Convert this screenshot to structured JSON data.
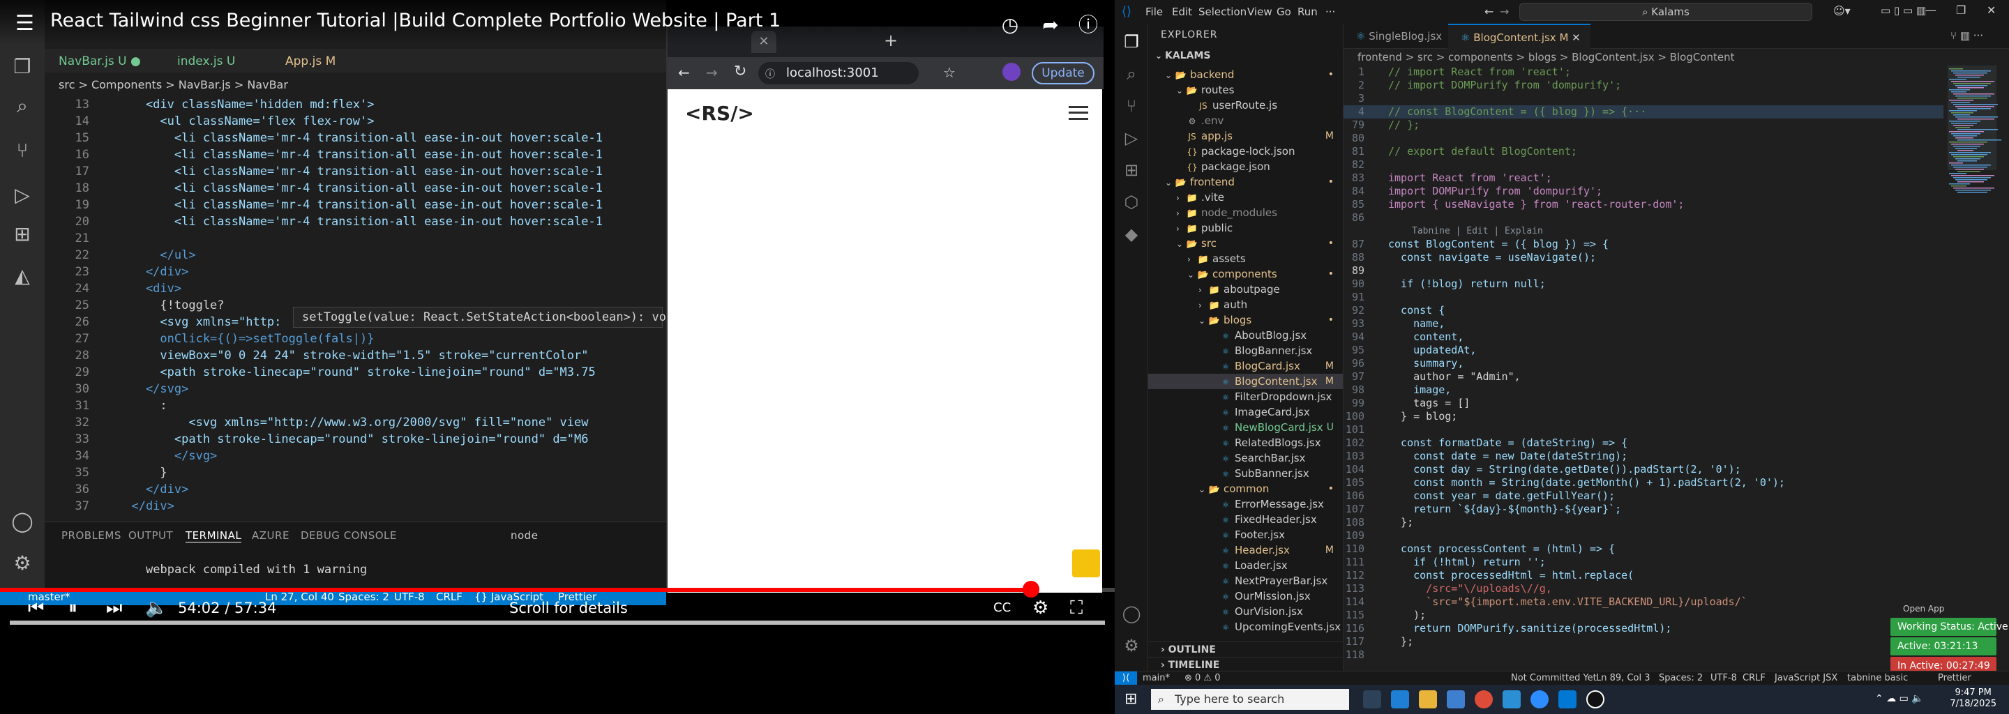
{
  "video": {
    "title": "React Tailwind css Beginner Tutorial |Build Complete Portfolio Website | Part 1",
    "time": "54:02 / 57:34",
    "scroll_hint": "Scroll for details",
    "progress": 0.925,
    "inner_tabs": [
      {
        "label": "NavBar.js",
        "badge": "U"
      },
      {
        "label": "index.js",
        "badge": "U"
      },
      {
        "label": "App.js",
        "badge": "M"
      }
    ],
    "inner_breadcrumb": "src > Components > NavBar.js > NavBar",
    "hover_tooltip": "setToggle(value: React.SetStateAction<boolean>): void",
    "panel_tabs": [
      "PROBLEMS",
      "OUTPUT",
      "TERMINAL",
      "AZURE",
      "DEBUG CONSOLE"
    ],
    "terminal_node": "node",
    "terminal_text": "webpack compiled with 1 warning",
    "status_left": "master*",
    "status_items": [
      "Ln 27, Col 40",
      "Spaces: 2",
      "UTF-8",
      "CRLF",
      "{} JavaScript",
      "Prettier"
    ],
    "browser_url": "localhost:3001",
    "browser_update": "Update",
    "site_logo": "<RS/>",
    "code_lines": [
      {
        "n": "13",
        "t": "    <div className='hidden md:flex'>"
      },
      {
        "n": "14",
        "t": "      <ul className='flex flex-row'>"
      },
      {
        "n": "15",
        "t": "        <li className='mr-4 transition-all ease-in-out hover:scale-1"
      },
      {
        "n": "16",
        "t": "        <li className='mr-4 transition-all ease-in-out hover:scale-1"
      },
      {
        "n": "17",
        "t": "        <li className='mr-4 transition-all ease-in-out hover:scale-1"
      },
      {
        "n": "18",
        "t": "        <li className='mr-4 transition-all ease-in-out hover:scale-1"
      },
      {
        "n": "19",
        "t": "        <li className='mr-4 transition-all ease-in-out hover:scale-1"
      },
      {
        "n": "20",
        "t": "        <li className='mr-4 transition-all ease-in-out hover:scale-1"
      },
      {
        "n": "21",
        "t": ""
      },
      {
        "n": "22",
        "t": "      </ul>"
      },
      {
        "n": "23",
        "t": "    </div>"
      },
      {
        "n": "24",
        "t": "    <div>"
      },
      {
        "n": "25",
        "t": "      {!toggle?"
      },
      {
        "n": "26",
        "t": "      <svg xmlns=\"http:"
      },
      {
        "n": "27",
        "t": "      onClick={()=>setToggle(fals|)}"
      },
      {
        "n": "28",
        "t": "      viewBox=\"0 0 24 24\" stroke-width=\"1.5\" stroke=\"currentColor\""
      },
      {
        "n": "29",
        "t": "      <path stroke-linecap=\"round\" stroke-linejoin=\"round\" d=\"M3.75"
      },
      {
        "n": "30",
        "t": "    </svg>"
      },
      {
        "n": "31",
        "t": "      :"
      },
      {
        "n": "32",
        "t": "          <svg xmlns=\"http://www.w3.org/2000/svg\" fill=\"none\" view"
      },
      {
        "n": "33",
        "t": "        <path stroke-linecap=\"round\" stroke-linejoin=\"round\" d=\"M6"
      },
      {
        "n": "34",
        "t": "        </svg>"
      },
      {
        "n": "35",
        "t": "      }"
      },
      {
        "n": "36",
        "t": "    </div>"
      },
      {
        "n": "37",
        "t": "  </div>"
      }
    ]
  },
  "editor": {
    "menu": [
      "File",
      "Edit",
      "Selection",
      "View",
      "Go",
      "Run",
      "···"
    ],
    "search": "Kalams",
    "explorer_title": "EXPLORER",
    "project": "KALAMS",
    "tabs": [
      {
        "label": "SingleBlog.jsx",
        "active": false
      },
      {
        "label": "BlogContent.jsx M",
        "active": true
      }
    ],
    "breadcrumb": "frontend > src > components > blogs > BlogContent.jsx > BlogContent",
    "tree": [
      {
        "label": "backend",
        "depth": 1,
        "type": "folder",
        "open": true,
        "badge": "•",
        "bc": "#e2c08d",
        "color": "#e2c08d"
      },
      {
        "label": "routes",
        "depth": 2,
        "type": "folder",
        "open": true,
        "badge": "",
        "bc": "",
        "color": "#cccccc"
      },
      {
        "label": "userRoute.js",
        "depth": 3,
        "type": "js",
        "open": false,
        "badge": "",
        "bc": "",
        "color": "#cccccc"
      },
      {
        "label": ".env",
        "depth": 2,
        "type": "env",
        "open": false,
        "badge": "",
        "bc": "",
        "color": "#8c8c8c"
      },
      {
        "label": "app.js",
        "depth": 2,
        "type": "js",
        "open": false,
        "badge": "M",
        "bc": "#e2c08d",
        "color": "#e2c08d"
      },
      {
        "label": "package-lock.json",
        "depth": 2,
        "type": "json",
        "open": false,
        "badge": "",
        "bc": "",
        "color": "#cccccc"
      },
      {
        "label": "package.json",
        "depth": 2,
        "type": "json",
        "open": false,
        "badge": "",
        "bc": "",
        "color": "#cccccc"
      },
      {
        "label": "frontend",
        "depth": 1,
        "type": "folder",
        "open": true,
        "badge": "•",
        "bc": "#e2c08d",
        "color": "#e2c08d"
      },
      {
        "label": ".vite",
        "depth": 2,
        "type": "folder",
        "open": false,
        "badge": "",
        "bc": "",
        "color": "#cccccc"
      },
      {
        "label": "node_modules",
        "depth": 2,
        "type": "folder",
        "open": false,
        "badge": "",
        "bc": "",
        "color": "#8c8c8c"
      },
      {
        "label": "public",
        "depth": 2,
        "type": "folder",
        "open": false,
        "badge": "",
        "bc": "",
        "color": "#cccccc"
      },
      {
        "label": "src",
        "depth": 2,
        "type": "folder",
        "open": true,
        "badge": "•",
        "bc": "#e2c08d",
        "color": "#e2c08d"
      },
      {
        "label": "assets",
        "depth": 3,
        "type": "folder",
        "open": false,
        "badge": "",
        "bc": "",
        "color": "#cccccc"
      },
      {
        "label": "components",
        "depth": 3,
        "type": "folder",
        "open": true,
        "badge": "•",
        "bc": "#e2c08d",
        "color": "#e2c08d"
      },
      {
        "label": "aboutpage",
        "depth": 4,
        "type": "folder",
        "open": false,
        "badge": "",
        "bc": "",
        "color": "#cccccc"
      },
      {
        "label": "auth",
        "depth": 4,
        "type": "folder",
        "open": false,
        "badge": "",
        "bc": "",
        "color": "#cccccc"
      },
      {
        "label": "blogs",
        "depth": 4,
        "type": "folder",
        "open": true,
        "badge": "•",
        "bc": "#e2c08d",
        "color": "#e2c08d"
      },
      {
        "label": "AboutBlog.jsx",
        "depth": 5,
        "type": "jsx",
        "open": false,
        "badge": "",
        "bc": "",
        "color": "#cccccc"
      },
      {
        "label": "BlogBanner.jsx",
        "depth": 5,
        "type": "jsx",
        "open": false,
        "badge": "",
        "bc": "",
        "color": "#cccccc"
      },
      {
        "label": "BlogCard.jsx",
        "depth": 5,
        "type": "jsx",
        "open": false,
        "badge": "M",
        "bc": "#e2c08d",
        "color": "#e2c08d"
      },
      {
        "label": "BlogContent.jsx",
        "depth": 5,
        "type": "jsx",
        "open": false,
        "badge": "M",
        "bc": "#e2c08d",
        "color": "#e2c08d",
        "selected": true
      },
      {
        "label": "FilterDropdown.jsx",
        "depth": 5,
        "type": "jsx",
        "open": false,
        "badge": "",
        "bc": "",
        "color": "#cccccc"
      },
      {
        "label": "ImageCard.jsx",
        "depth": 5,
        "type": "jsx",
        "open": false,
        "badge": "",
        "bc": "",
        "color": "#cccccc"
      },
      {
        "label": "NewBlogCard.jsx",
        "depth": 5,
        "type": "jsx",
        "open": false,
        "badge": "U",
        "bc": "#73c991",
        "color": "#73c991"
      },
      {
        "label": "RelatedBlogs.jsx",
        "depth": 5,
        "type": "jsx",
        "open": false,
        "badge": "",
        "bc": "",
        "color": "#cccccc"
      },
      {
        "label": "SearchBar.jsx",
        "depth": 5,
        "type": "jsx",
        "open": false,
        "badge": "",
        "bc": "",
        "color": "#cccccc"
      },
      {
        "label": "SubBanner.jsx",
        "depth": 5,
        "type": "jsx",
        "open": false,
        "badge": "",
        "bc": "",
        "color": "#cccccc"
      },
      {
        "label": "common",
        "depth": 4,
        "type": "folder",
        "open": true,
        "badge": "•",
        "bc": "#e2c08d",
        "color": "#e2c08d"
      },
      {
        "label": "ErrorMessage.jsx",
        "depth": 5,
        "type": "jsx",
        "open": false,
        "badge": "",
        "bc": "",
        "color": "#cccccc"
      },
      {
        "label": "FixedHeader.jsx",
        "depth": 5,
        "type": "jsx",
        "open": false,
        "badge": "",
        "bc": "",
        "color": "#cccccc"
      },
      {
        "label": "Footer.jsx",
        "depth": 5,
        "type": "jsx",
        "open": false,
        "badge": "",
        "bc": "",
        "color": "#cccccc"
      },
      {
        "label": "Header.jsx",
        "depth": 5,
        "type": "jsx",
        "open": false,
        "badge": "M",
        "bc": "#e2c08d",
        "color": "#e2c08d"
      },
      {
        "label": "Loader.jsx",
        "depth": 5,
        "type": "jsx",
        "open": false,
        "badge": "",
        "bc": "",
        "color": "#cccccc"
      },
      {
        "label": "NextPrayerBar.jsx",
        "depth": 5,
        "type": "jsx",
        "open": false,
        "badge": "",
        "bc": "",
        "color": "#cccccc"
      },
      {
        "label": "OurMission.jsx",
        "depth": 5,
        "type": "jsx",
        "open": false,
        "badge": "",
        "bc": "",
        "color": "#cccccc"
      },
      {
        "label": "OurVision.jsx",
        "depth": 5,
        "type": "jsx",
        "open": false,
        "badge": "",
        "bc": "",
        "color": "#cccccc"
      },
      {
        "label": "UpcomingEvents.jsx",
        "depth": 5,
        "type": "jsx",
        "open": false,
        "badge": "",
        "bc": "",
        "color": "#cccccc"
      }
    ],
    "outline": "OUTLINE",
    "timeline": "TIMELINE",
    "tabnine_hint": "Tabnine | Edit | Explain",
    "code_lines": [
      {
        "n": "1",
        "c": "k-cm",
        "t": "// import React from 'react';"
      },
      {
        "n": "2",
        "c": "k-cm",
        "t": "// import DOMPurify from 'dompurify';"
      },
      {
        "n": "3",
        "c": "",
        "t": ""
      },
      {
        "n": "4",
        "c": "k-cm",
        "t": "// const BlogContent = ({ blog }) => {···"
      },
      {
        "n": "79",
        "c": "k-cm",
        "t": "// };"
      },
      {
        "n": "80",
        "c": "",
        "t": ""
      },
      {
        "n": "81",
        "c": "k-cm",
        "t": "// export default BlogContent;"
      },
      {
        "n": "82",
        "c": "",
        "t": ""
      },
      {
        "n": "83",
        "c": "",
        "t": "import React from 'react';"
      },
      {
        "n": "84",
        "c": "",
        "t": "import DOMPurify from 'dompurify';"
      },
      {
        "n": "85",
        "c": "",
        "t": "import { useNavigate } from 'react-router-dom';"
      },
      {
        "n": "86",
        "c": "",
        "t": ""
      },
      {
        "n": "87",
        "c": "",
        "t": "const BlogContent = ({ blog }) => {"
      },
      {
        "n": "88",
        "c": "",
        "t": "  const navigate = useNavigate();"
      },
      {
        "n": "89",
        "c": "",
        "t": ""
      },
      {
        "n": "90",
        "c": "",
        "t": "  if (!blog) return null;"
      },
      {
        "n": "91",
        "c": "",
        "t": ""
      },
      {
        "n": "92",
        "c": "",
        "t": "  const {"
      },
      {
        "n": "93",
        "c": "k-var",
        "t": "    name,"
      },
      {
        "n": "94",
        "c": "k-var",
        "t": "    content,"
      },
      {
        "n": "95",
        "c": "k-var",
        "t": "    updatedAt,"
      },
      {
        "n": "96",
        "c": "k-var",
        "t": "    summary,"
      },
      {
        "n": "97",
        "c": "",
        "t": "    author = \"Admin\","
      },
      {
        "n": "98",
        "c": "k-var",
        "t": "    image,"
      },
      {
        "n": "99",
        "c": "",
        "t": "    tags = []"
      },
      {
        "n": "100",
        "c": "",
        "t": "  } = blog;"
      },
      {
        "n": "101",
        "c": "",
        "t": ""
      },
      {
        "n": "102",
        "c": "",
        "t": "  const formatDate = (dateString) => {"
      },
      {
        "n": "103",
        "c": "",
        "t": "    const date = new Date(dateString);"
      },
      {
        "n": "104",
        "c": "",
        "t": "    const day = String(date.getDate()).padStart(2, '0');"
      },
      {
        "n": "105",
        "c": "",
        "t": "    const month = String(date.getMonth() + 1).padStart(2, '0');"
      },
      {
        "n": "106",
        "c": "",
        "t": "    const year = date.getFullYear();"
      },
      {
        "n": "107",
        "c": "",
        "t": "    return `${day}-${month}-${year}`;"
      },
      {
        "n": "108",
        "c": "",
        "t": "  };"
      },
      {
        "n": "109",
        "c": "",
        "t": ""
      },
      {
        "n": "110",
        "c": "",
        "t": "  const processContent = (html) => {"
      },
      {
        "n": "111",
        "c": "",
        "t": "    if (!html) return '';"
      },
      {
        "n": "112",
        "c": "",
        "t": "    const processedHtml = html.replace("
      },
      {
        "n": "113",
        "c": "k-re",
        "t": "      /src=\"\\/uploads\\//g,"
      },
      {
        "n": "114",
        "c": "k-str",
        "t": "      `src=\"${import.meta.env.VITE_BACKEND_URL}/uploads/`"
      },
      {
        "n": "115",
        "c": "",
        "t": "    );"
      },
      {
        "n": "116",
        "c": "",
        "t": "    return DOMPurify.sanitize(processedHtml);"
      },
      {
        "n": "117",
        "c": "",
        "t": "  };"
      },
      {
        "n": "118",
        "c": "",
        "t": ""
      }
    ],
    "open_app": "Open App",
    "working_status": "Working Status: Active",
    "active_time": "Active: 03:21:13",
    "inactive_time": "In Active: 00:27:49",
    "status_bar": {
      "branch": "main*",
      "problems": "⊗ 0 ⚠ 0",
      "commit": "Not Committed Yet",
      "cursor": "Ln 89, Col 3",
      "spaces": "Spaces: 2",
      "encoding": "UTF-8",
      "eol": "CRLF",
      "lang": "JavaScript JSX",
      "tabnine": "tabnine basic",
      "prettier": "Prettier"
    }
  },
  "taskbar": {
    "search_placeholder": "Type here to search",
    "time": "9:47 PM",
    "date": "7/18/2025"
  },
  "colors": {
    "accent_blue": "#007acc",
    "progress_red": "#ff0000",
    "pill_green": "#2ea043",
    "pill_red": "#c93c37"
  }
}
